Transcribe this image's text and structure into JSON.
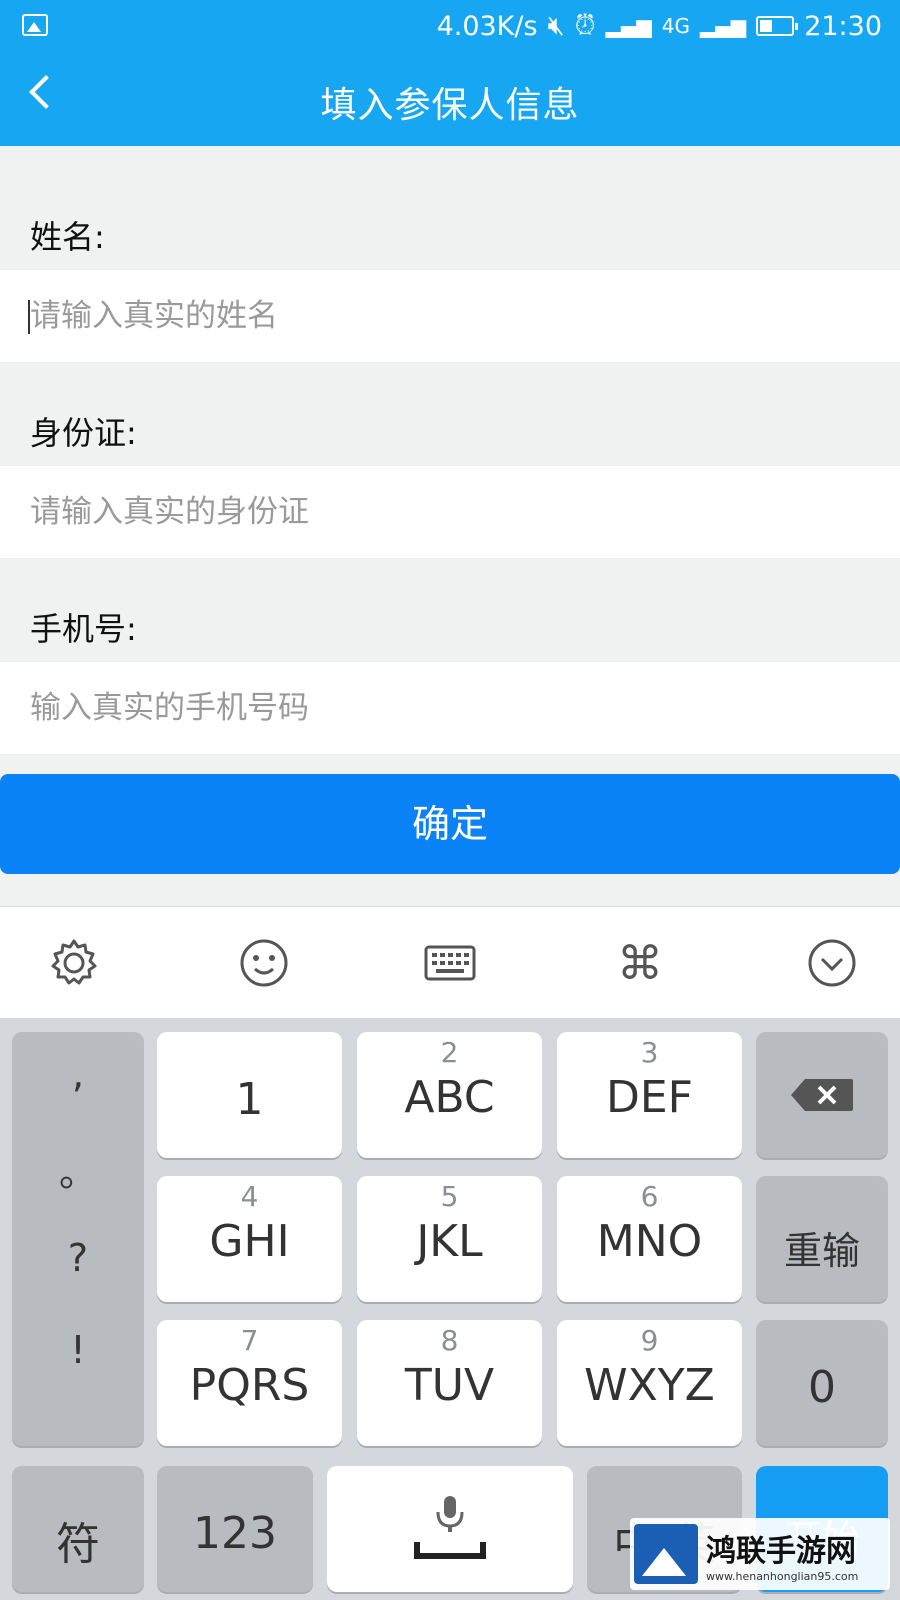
{
  "status_bar": {
    "speed": "4.03K/s",
    "network": "4G",
    "time": "21:30"
  },
  "header": {
    "title": "填入参保人信息"
  },
  "form": {
    "name_label": "姓名:",
    "name_placeholder": "请输入真实的姓名",
    "id_label": "身份证:",
    "id_placeholder": "请输入真实的身份证",
    "phone_label": "手机号:",
    "phone_placeholder": "输入真实的手机号码",
    "confirm_label": "确定"
  },
  "keyboard": {
    "toolbar_icons": [
      "gear-icon",
      "emoji-icon",
      "keyboard-icon",
      "command-icon",
      "chevron-down-icon"
    ],
    "punctuation": [
      ",",
      "。",
      "?",
      "!"
    ],
    "keys": [
      {
        "num": "",
        "letters": "1"
      },
      {
        "num": "2",
        "letters": "ABC"
      },
      {
        "num": "3",
        "letters": "DEF"
      },
      {
        "num": "4",
        "letters": "GHI"
      },
      {
        "num": "5",
        "letters": "JKL"
      },
      {
        "num": "6",
        "letters": "MNO"
      },
      {
        "num": "7",
        "letters": "PQRS"
      },
      {
        "num": "8",
        "letters": "TUV"
      },
      {
        "num": "9",
        "letters": "WXYZ"
      }
    ],
    "reinput_label": "重输",
    "zero_label": "0",
    "symbol_label": "符",
    "numbers_label": "123",
    "lang_label": "中/英",
    "start_label": "开始"
  },
  "watermark": {
    "title": "鸿联手游网",
    "url": "www.henanhonglian95.com"
  }
}
